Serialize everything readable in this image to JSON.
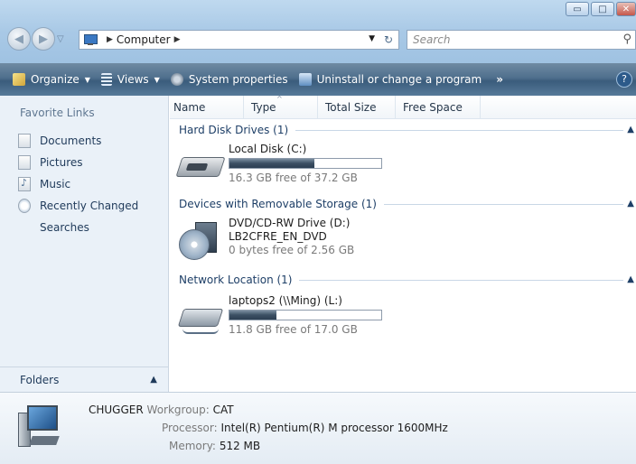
{
  "window": {
    "minimize_glyph": "▭",
    "maximize_glyph": "□",
    "close_glyph": "✕"
  },
  "address": {
    "crumbs": [
      "Computer"
    ],
    "search_placeholder": "Search"
  },
  "toolbar": {
    "organize": "Organize",
    "views": "Views",
    "system_properties": "System properties",
    "uninstall": "Uninstall or change a program",
    "more": "»",
    "help": "?"
  },
  "left_pane": {
    "title": "Favorite Links",
    "items": [
      {
        "label": "Documents",
        "icon": "documents-icon"
      },
      {
        "label": "Pictures",
        "icon": "pictures-icon"
      },
      {
        "label": "Music",
        "icon": "music-icon"
      },
      {
        "label": "Recently Changed",
        "icon": "recently-changed-icon"
      },
      {
        "label": "Searches",
        "icon": "searches-icon"
      }
    ],
    "folders_label": "Folders",
    "folders_chevron": "▲"
  },
  "columns": [
    "Name",
    "Type",
    "Total Size",
    "Free Space"
  ],
  "groups": {
    "hdd": {
      "title": "Hard Disk Drives (1)",
      "drive": {
        "name": "Local Disk (C:)",
        "sub": "16.3 GB free of 37.2 GB",
        "used_fraction": 0.56
      }
    },
    "removable": {
      "title": "Devices with Removable Storage (1)",
      "drive": {
        "name": "DVD/CD-RW Drive (D:)",
        "label": "LB2CFRE_EN_DVD",
        "sub": "0 bytes free of 2.56 GB"
      }
    },
    "network": {
      "title": "Network Location (1)",
      "drive": {
        "name": "laptops2 (\\\\Ming) (L:)",
        "sub": "11.8 GB free of 17.0 GB",
        "used_fraction": 0.31
      }
    }
  },
  "details": {
    "computer_name": "CHUGGER",
    "workgroup_label": "Workgroup:",
    "workgroup": "CAT",
    "processor_label": "Processor:",
    "processor": "Intel(R) Pentium(R) M processor 1600MHz",
    "memory_label": "Memory:",
    "memory": "512 MB"
  }
}
